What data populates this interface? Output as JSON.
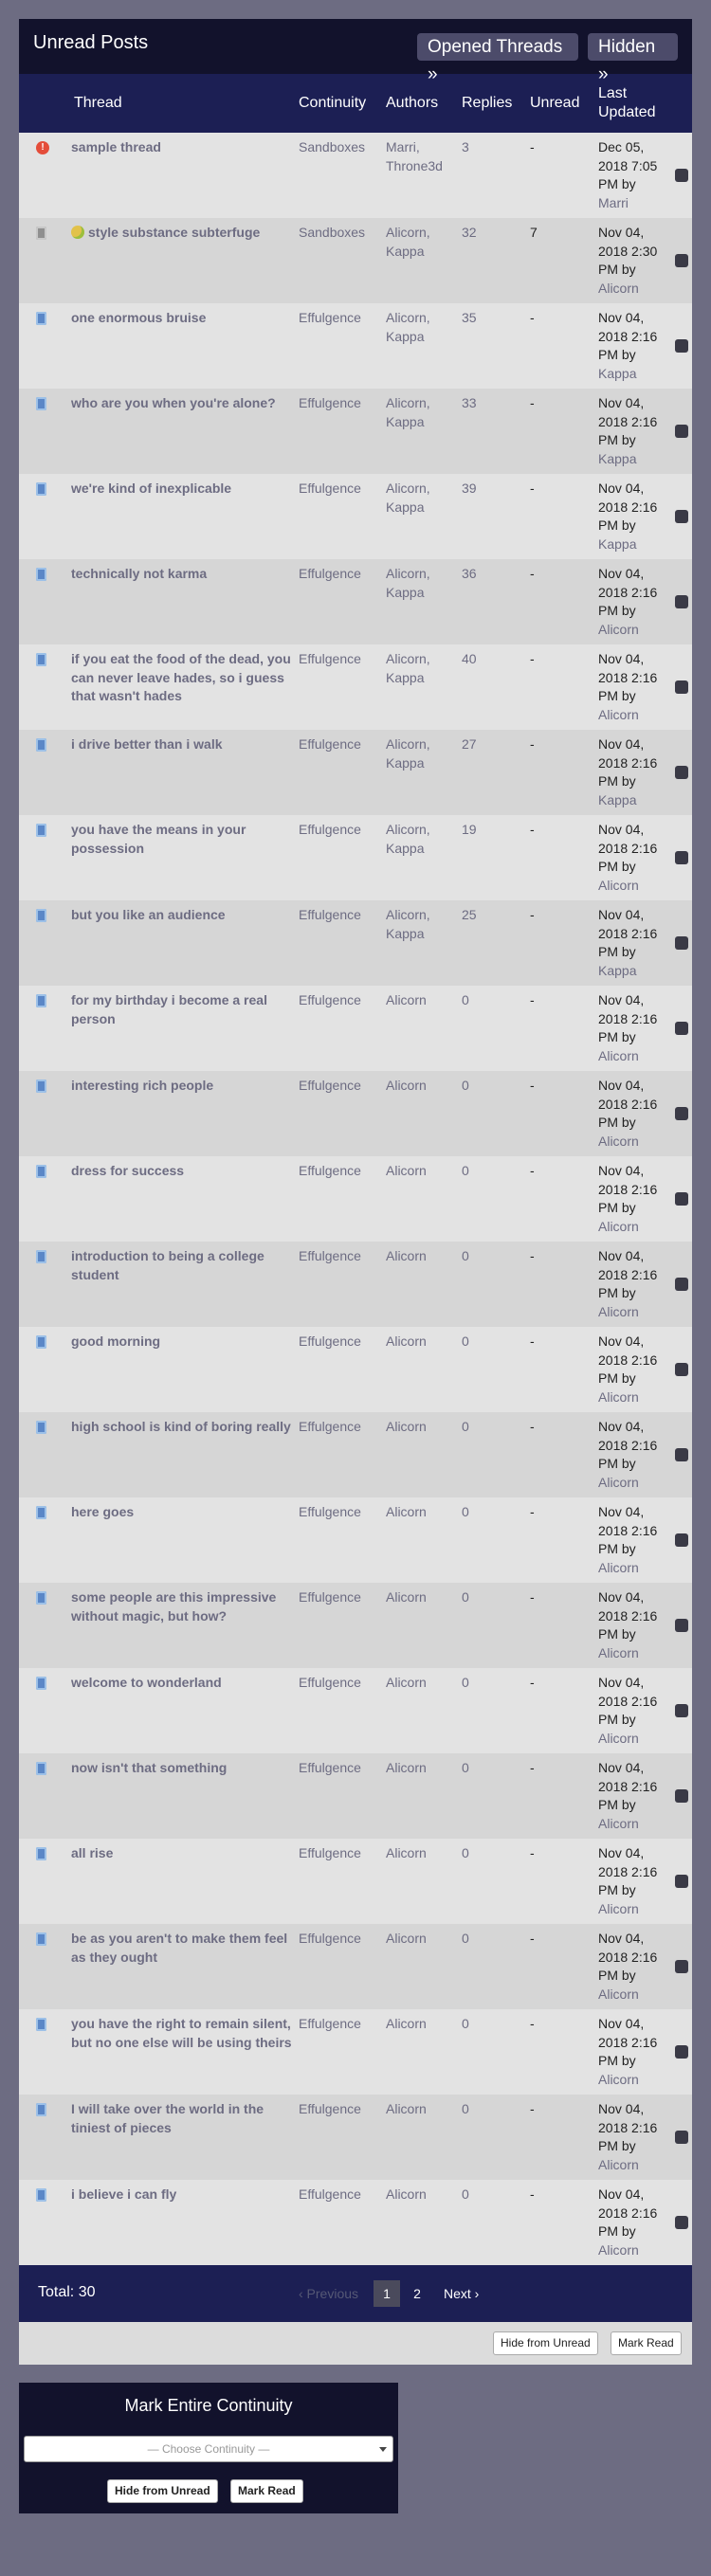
{
  "header": {
    "title": "Unread Posts",
    "opened_threads_label": "Opened Threads »",
    "hidden_label": "Hidden »"
  },
  "columns": {
    "thread": "Thread",
    "continuity": "Continuity",
    "authors": "Authors",
    "replies": "Replies",
    "unread": "Unread",
    "last_updated": "Last Updated"
  },
  "rows": [
    {
      "icon": "alert-icon",
      "title": "sample thread",
      "continuity": "Sandboxes",
      "authors": "Marri, Throne3d",
      "replies": "3",
      "unread": "-",
      "updated": "Dec 05, 2018 7:05 PM by",
      "updated_by": "Marri"
    },
    {
      "icon": "read-page-icon",
      "title": "style substance subterfuge",
      "continuity": "Sandboxes",
      "authors": "Alicorn, Kappa",
      "replies": "32",
      "unread": "7",
      "updated": "Nov 04, 2018 2:30 PM by",
      "updated_by": "Alicorn"
    },
    {
      "icon": "page-icon",
      "title": "one enormous bruise",
      "continuity": "Effulgence",
      "authors": "Alicorn, Kappa",
      "replies": "35",
      "unread": "-",
      "updated": "Nov 04, 2018 2:16 PM by",
      "updated_by": "Kappa"
    },
    {
      "icon": "page-icon",
      "title": "who are you when you're alone?",
      "continuity": "Effulgence",
      "authors": "Alicorn, Kappa",
      "replies": "33",
      "unread": "-",
      "updated": "Nov 04, 2018 2:16 PM by",
      "updated_by": "Kappa"
    },
    {
      "icon": "page-icon",
      "title": "we're kind of inexplicable",
      "continuity": "Effulgence",
      "authors": "Alicorn, Kappa",
      "replies": "39",
      "unread": "-",
      "updated": "Nov 04, 2018 2:16 PM by",
      "updated_by": "Kappa"
    },
    {
      "icon": "page-icon",
      "title": "technically not karma",
      "continuity": "Effulgence",
      "authors": "Alicorn, Kappa",
      "replies": "36",
      "unread": "-",
      "updated": "Nov 04, 2018 2:16 PM by",
      "updated_by": "Alicorn"
    },
    {
      "icon": "page-icon",
      "title": "if you eat the food of the dead, you can never leave hades, so i guess that wasn't hades",
      "continuity": "Effulgence",
      "authors": "Alicorn, Kappa",
      "replies": "40",
      "unread": "-",
      "updated": "Nov 04, 2018 2:16 PM by",
      "updated_by": "Alicorn"
    },
    {
      "icon": "page-icon",
      "title": "i drive better than i walk",
      "continuity": "Effulgence",
      "authors": "Alicorn, Kappa",
      "replies": "27",
      "unread": "-",
      "updated": "Nov 04, 2018 2:16 PM by",
      "updated_by": "Kappa"
    },
    {
      "icon": "page-icon",
      "title": "you have the means in your possession",
      "continuity": "Effulgence",
      "authors": "Alicorn, Kappa",
      "replies": "19",
      "unread": "-",
      "updated": "Nov 04, 2018 2:16 PM by",
      "updated_by": "Alicorn"
    },
    {
      "icon": "page-icon",
      "title": "but you like an audience",
      "continuity": "Effulgence",
      "authors": "Alicorn, Kappa",
      "replies": "25",
      "unread": "-",
      "updated": "Nov 04, 2018 2:16 PM by",
      "updated_by": "Kappa"
    },
    {
      "icon": "page-icon",
      "title": "for my birthday i become a real person",
      "continuity": "Effulgence",
      "authors": "Alicorn",
      "replies": "0",
      "unread": "-",
      "updated": "Nov 04, 2018 2:16 PM by",
      "updated_by": "Alicorn"
    },
    {
      "icon": "page-icon",
      "title": "interesting rich people",
      "continuity": "Effulgence",
      "authors": "Alicorn",
      "replies": "0",
      "unread": "-",
      "updated": "Nov 04, 2018 2:16 PM by",
      "updated_by": "Alicorn"
    },
    {
      "icon": "page-icon",
      "title": "dress for success",
      "continuity": "Effulgence",
      "authors": "Alicorn",
      "replies": "0",
      "unread": "-",
      "updated": "Nov 04, 2018 2:16 PM by",
      "updated_by": "Alicorn"
    },
    {
      "icon": "page-icon",
      "title": "introduction to being a college student",
      "continuity": "Effulgence",
      "authors": "Alicorn",
      "replies": "0",
      "unread": "-",
      "updated": "Nov 04, 2018 2:16 PM by",
      "updated_by": "Alicorn"
    },
    {
      "icon": "page-icon",
      "title": "good morning",
      "continuity": "Effulgence",
      "authors": "Alicorn",
      "replies": "0",
      "unread": "-",
      "updated": "Nov 04, 2018 2:16 PM by",
      "updated_by": "Alicorn"
    },
    {
      "icon": "page-icon",
      "title": "high school is kind of boring really",
      "continuity": "Effulgence",
      "authors": "Alicorn",
      "replies": "0",
      "unread": "-",
      "updated": "Nov 04, 2018 2:16 PM by",
      "updated_by": "Alicorn"
    },
    {
      "icon": "page-icon",
      "title": "here goes",
      "continuity": "Effulgence",
      "authors": "Alicorn",
      "replies": "0",
      "unread": "-",
      "updated": "Nov 04, 2018 2:16 PM by",
      "updated_by": "Alicorn"
    },
    {
      "icon": "page-icon",
      "title": "some people are this impressive without magic, but how?",
      "continuity": "Effulgence",
      "authors": "Alicorn",
      "replies": "0",
      "unread": "-",
      "updated": "Nov 04, 2018 2:16 PM by",
      "updated_by": "Alicorn"
    },
    {
      "icon": "page-icon",
      "title": "welcome to wonderland",
      "continuity": "Effulgence",
      "authors": "Alicorn",
      "replies": "0",
      "unread": "-",
      "updated": "Nov 04, 2018 2:16 PM by",
      "updated_by": "Alicorn"
    },
    {
      "icon": "page-icon",
      "title": "now isn't that something",
      "continuity": "Effulgence",
      "authors": "Alicorn",
      "replies": "0",
      "unread": "-",
      "updated": "Nov 04, 2018 2:16 PM by",
      "updated_by": "Alicorn"
    },
    {
      "icon": "page-icon",
      "title": "all rise",
      "continuity": "Effulgence",
      "authors": "Alicorn",
      "replies": "0",
      "unread": "-",
      "updated": "Nov 04, 2018 2:16 PM by",
      "updated_by": "Alicorn"
    },
    {
      "icon": "page-icon",
      "title": "be as you aren't to make them feel as they ought",
      "continuity": "Effulgence",
      "authors": "Alicorn",
      "replies": "0",
      "unread": "-",
      "updated": "Nov 04, 2018 2:16 PM by",
      "updated_by": "Alicorn"
    },
    {
      "icon": "page-icon",
      "title": "you have the right to remain silent, but no one else will be using theirs",
      "continuity": "Effulgence",
      "authors": "Alicorn",
      "replies": "0",
      "unread": "-",
      "updated": "Nov 04, 2018 2:16 PM by",
      "updated_by": "Alicorn"
    },
    {
      "icon": "page-icon",
      "title": "I will take over the world in the tiniest of pieces",
      "continuity": "Effulgence",
      "authors": "Alicorn",
      "replies": "0",
      "unread": "-",
      "updated": "Nov 04, 2018 2:16 PM by",
      "updated_by": "Alicorn"
    },
    {
      "icon": "page-icon",
      "title": "i believe i can fly",
      "continuity": "Effulgence",
      "authors": "Alicorn",
      "replies": "0",
      "unread": "-",
      "updated": "Nov 04, 2018 2:16 PM by",
      "updated_by": "Alicorn"
    }
  ],
  "footer": {
    "total": "Total: 30",
    "previous": "‹ Previous",
    "page1": "1",
    "page2": "2",
    "next": "Next ›"
  },
  "actions": {
    "hide_label": "Hide from Unread",
    "mark_label": "Mark Read"
  },
  "mark_continuity": {
    "title": "Mark Entire Continuity",
    "select_placeholder": "— Choose Continuity —",
    "hide_label": "Hide from Unread",
    "mark_label": "Mark Read"
  },
  "colors": {
    "page_bg": "#6d6c82",
    "header_bg": "#12122c",
    "table_head_bg": "#1c1f54",
    "row_odd": "#e3e3e3",
    "row_even": "#d6d6d6",
    "link": "#6d6c82"
  }
}
